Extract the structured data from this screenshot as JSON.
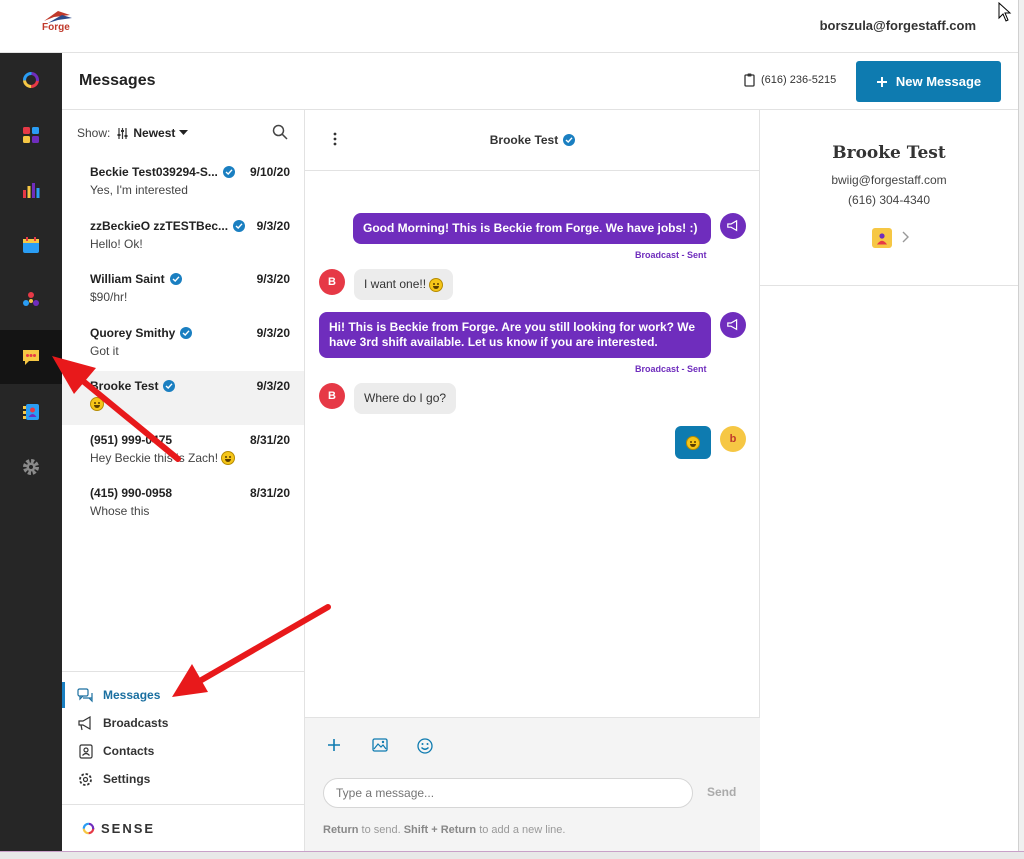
{
  "topbar": {
    "brand": "Forge",
    "user_email": "borszula@forgestaff.com"
  },
  "header": {
    "title": "Messages",
    "phone": "(616) 236-5215",
    "new_message_label": "New Message"
  },
  "rail": {
    "items": [
      {
        "icon": "sense-logo-icon"
      },
      {
        "icon": "dashboard-icon"
      },
      {
        "icon": "analytics-icon"
      },
      {
        "icon": "calendar-icon"
      },
      {
        "icon": "integrations-icon"
      },
      {
        "icon": "messaging-icon",
        "active": true
      },
      {
        "icon": "contacts-icon"
      },
      {
        "icon": "settings-gear-icon"
      }
    ]
  },
  "conversations": {
    "show_label": "Show:",
    "sort_label": "Newest",
    "items": [
      {
        "name": "Beckie Test039294-S...",
        "date": "9/10/20",
        "preview": "Yes, I'm interested",
        "verified": true
      },
      {
        "name": "zzBeckieO zzTESTBec...",
        "date": "9/3/20",
        "preview": "Hello! Ok!",
        "verified": true
      },
      {
        "name": "William Saint",
        "date": "9/3/20",
        "preview": "$90/hr!",
        "verified": true
      },
      {
        "name": "Quorey Smithy",
        "date": "9/3/20",
        "preview": "Got it",
        "verified": true
      },
      {
        "name": "Brooke Test",
        "date": "9/3/20",
        "preview": "",
        "verified": true,
        "selected": true
      },
      {
        "name": "(951) 999-0475",
        "date": "8/31/20",
        "preview": "Hey Beckie this is Zach!",
        "verified": false
      },
      {
        "name": "(415) 990-0958",
        "date": "8/31/20",
        "preview": "Whose this",
        "verified": false
      }
    ]
  },
  "bottom_nav": {
    "messages": "Messages",
    "broadcasts": "Broadcasts",
    "contacts": "Contacts",
    "settings": "Settings"
  },
  "footer": {
    "brand": "SENSE"
  },
  "chat": {
    "contact_name": "Brooke Test",
    "messages": [
      {
        "direction": "out",
        "text": "Good Morning! This is Beckie from Forge.  We have jobs! :)",
        "meta": "Broadcast - Sent"
      },
      {
        "direction": "in",
        "text": "I want one!!",
        "avatar": "B"
      },
      {
        "direction": "out",
        "text": "Hi! This is Beckie from Forge. Are you still looking for work? We have 3rd shift available. Let us know if you are interested.",
        "meta": "Broadcast - Sent"
      },
      {
        "direction": "in",
        "text": "Where do I go?",
        "avatar": "B"
      },
      {
        "direction": "out",
        "text": "",
        "avatar": "b"
      }
    ],
    "composer": {
      "placeholder": "Type a message...",
      "send_label": "Send",
      "hint_key1": "Return",
      "hint_text1": " to send. ",
      "hint_key2": "Shift + Return",
      "hint_text2": " to add a new line."
    }
  },
  "contact": {
    "name": "Brooke Test",
    "email": "bwiig@forgestaff.com",
    "phone": "(616) 304-4340"
  },
  "colors": {
    "accent": "#0e7bb0",
    "broadcast_purple": "#6f2dbd",
    "rail": "#262626",
    "annotation_arrow": "#e8191b"
  }
}
